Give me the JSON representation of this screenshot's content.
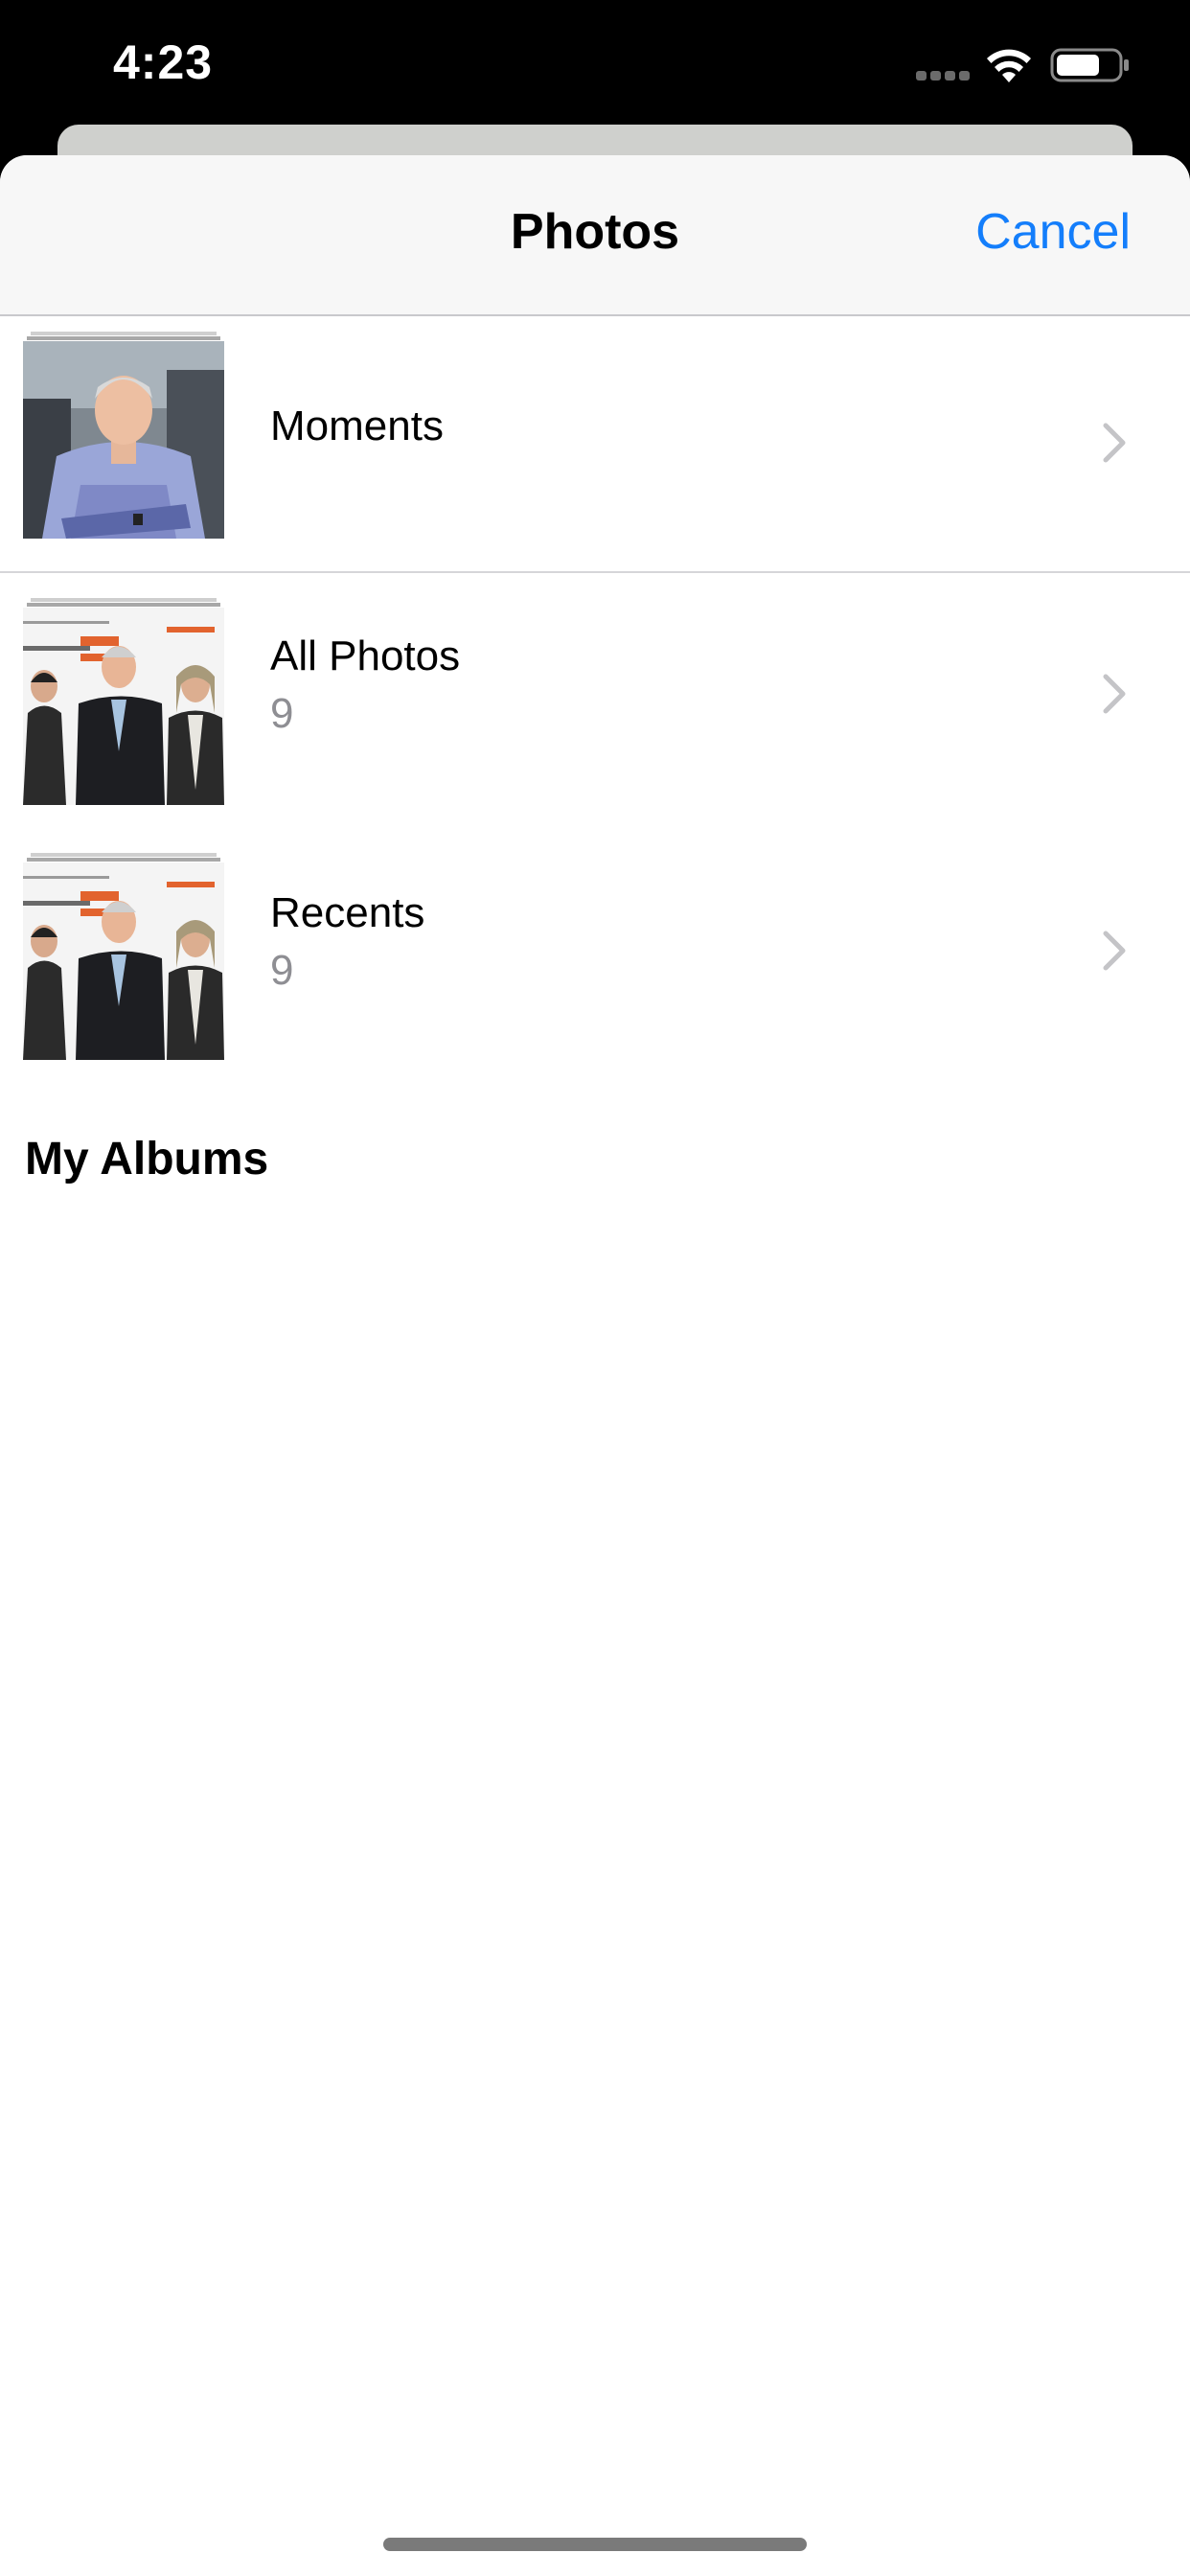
{
  "status_bar": {
    "time": "4:23",
    "signal_icon": "cellular-signal-icon",
    "wifi_icon": "wifi-icon",
    "battery_icon": "battery-icon"
  },
  "nav": {
    "title": "Photos",
    "cancel_label": "Cancel"
  },
  "rows": [
    {
      "title": "Moments",
      "count": "",
      "thumbnail": "portrait-man-checked-shirt",
      "icon": "chevron-right-icon"
    },
    {
      "title": "All Photos",
      "count": "9",
      "thumbnail": "three-men-grand-tour-event",
      "icon": "chevron-right-icon"
    },
    {
      "title": "Recents",
      "count": "9",
      "thumbnail": "three-men-grand-tour-event",
      "icon": "chevron-right-icon"
    }
  ],
  "section": {
    "my_albums": "My Albums"
  },
  "colors": {
    "accent": "#147efb",
    "secondary_text": "#8e8e93",
    "nav_background": "#f7f7f7"
  }
}
